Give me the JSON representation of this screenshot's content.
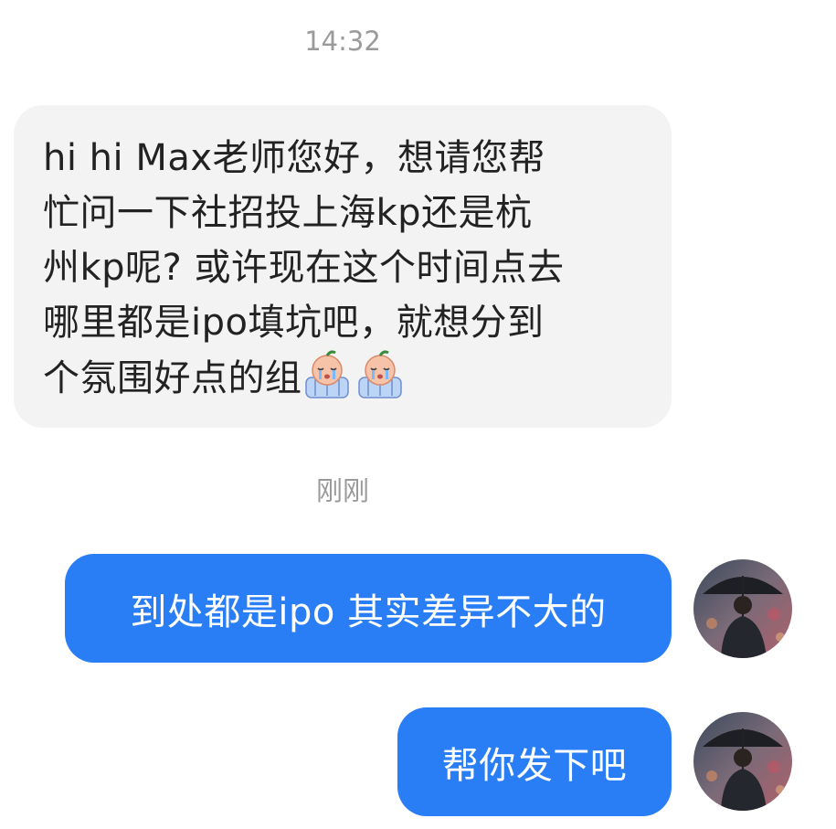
{
  "timestamps": {
    "first": "14:32",
    "second": "刚刚"
  },
  "messages": {
    "incoming": {
      "text": "hi hi Max老师您好，想请您帮\n忙问一下社招投上海kp还是杭\n州kp呢? 或许现在这个时间点去\n哪里都是ipo填坑吧，就想分到\n个氛围好点的组",
      "emoji": [
        "crying-baby-emoji",
        "crying-baby-emoji"
      ]
    },
    "outgoing": [
      {
        "text": "到处都是ipo 其实差异不大的"
      },
      {
        "text": "帮你发下吧"
      }
    ]
  },
  "colors": {
    "incoming_bubble": "#f3f3f3",
    "outgoing_bubble": "#2a7ef5",
    "timestamp": "#9a9a9a"
  }
}
